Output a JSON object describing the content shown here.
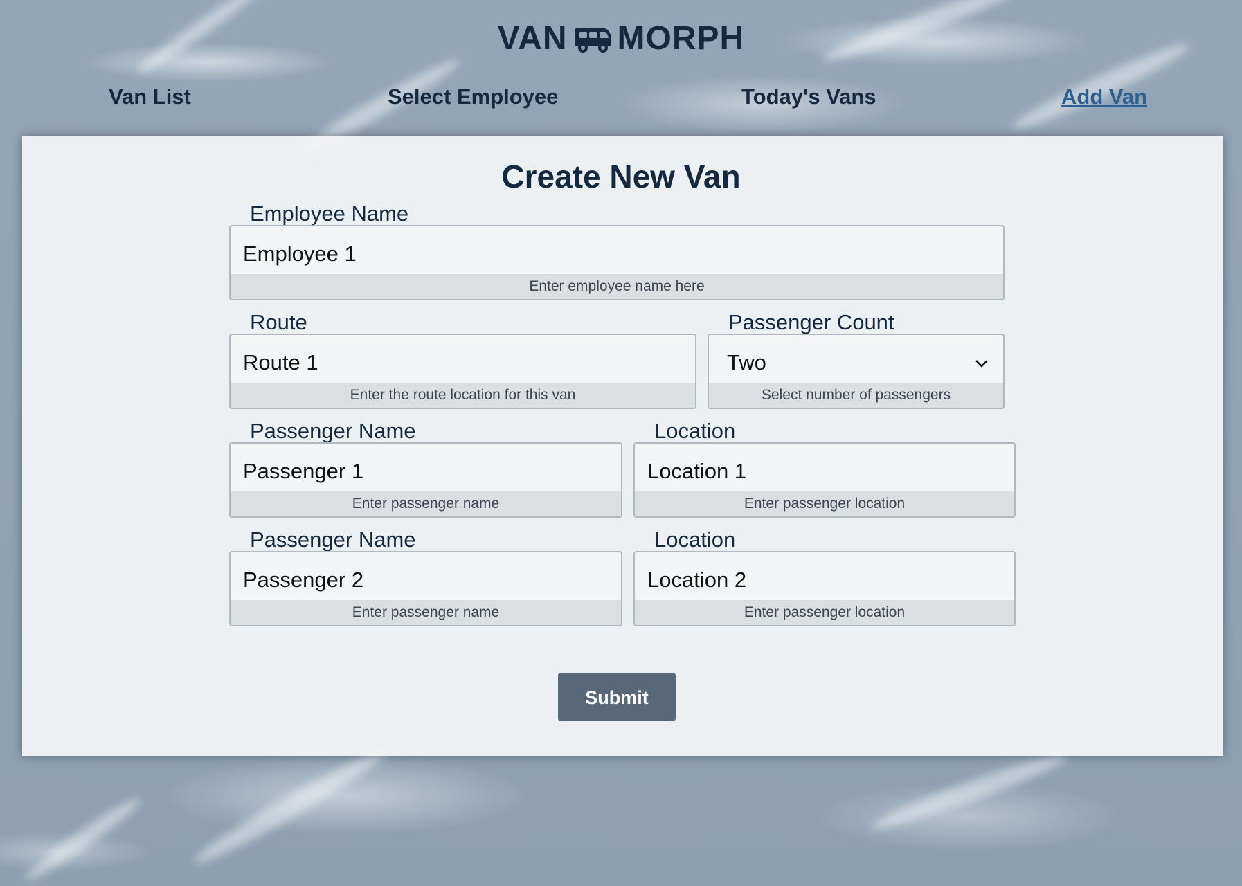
{
  "brand": {
    "left": "VAN",
    "right": "MORPH",
    "icon": "van-icon"
  },
  "nav": {
    "items": [
      {
        "label": "Van List"
      },
      {
        "label": "Select Employee"
      },
      {
        "label": "Today's Vans"
      },
      {
        "label": "Add Van",
        "active": true
      }
    ]
  },
  "form": {
    "title": "Create New Van",
    "employee": {
      "label": "Employee Name",
      "value": "Employee 1",
      "help": "Enter employee name here"
    },
    "route": {
      "label": "Route",
      "value": "Route 1",
      "help": "Enter the route location for this van"
    },
    "passenger_count": {
      "label": "Passenger Count",
      "value": "Two",
      "help": "Select number of passengers",
      "icon": "chevron-down-icon"
    },
    "passengers": [
      {
        "name_label": "Passenger Name",
        "name_value": "Passenger 1",
        "name_help": "Enter passenger name",
        "loc_label": "Location",
        "loc_value": "Location 1",
        "loc_help": "Enter passenger location"
      },
      {
        "name_label": "Passenger Name",
        "name_value": "Passenger 2",
        "name_help": "Enter passenger name",
        "loc_label": "Location",
        "loc_value": "Location 2",
        "loc_help": "Enter passenger location"
      }
    ],
    "submit_label": "Submit"
  },
  "colors": {
    "text_dark": "#14283f",
    "active_link": "#2f5f8e",
    "button": "#566879",
    "background": "#8fa2b4"
  }
}
